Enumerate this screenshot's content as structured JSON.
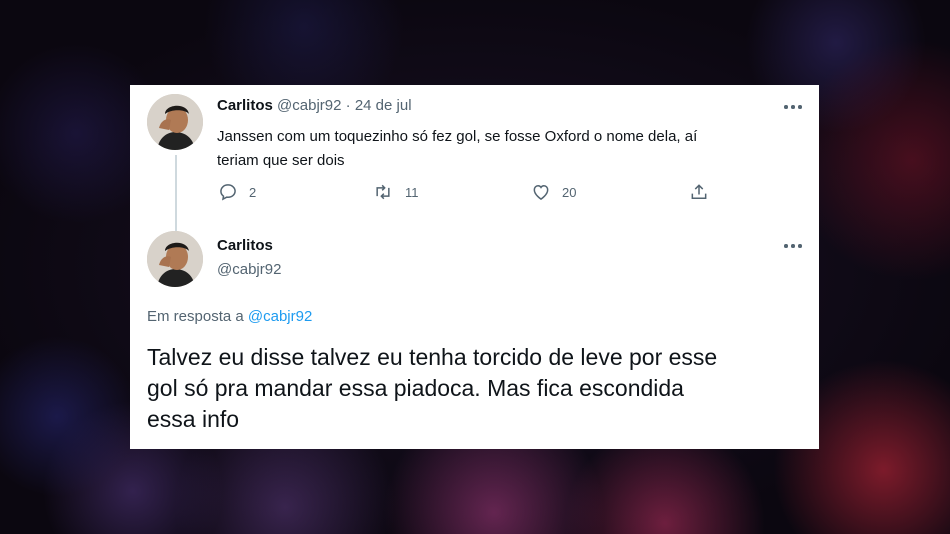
{
  "tweet1": {
    "name": "Carlitos",
    "handle": "@cabjr92",
    "separator": "·",
    "date": "24 de jul",
    "text_line1": "Janssen com um toquezinho só fez gol, se fosse Oxford o nome dela, aí",
    "text_line2": "teriam que ser dois",
    "replies": "2",
    "retweets": "11",
    "likes": "20"
  },
  "tweet2": {
    "name": "Carlitos",
    "handle": "@cabjr92",
    "reply_prefix": "Em resposta a",
    "reply_to": "@cabjr92",
    "text_line1": "Talvez eu disse talvez eu tenha torcido de leve por esse",
    "text_line2": "gol só pra mandar essa piadoca. Mas fica escondida",
    "text_line3": "essa info"
  },
  "colors": {
    "link": "#1d9bf0",
    "text": "#0f1419",
    "muted": "#536471",
    "card": "#ffffff"
  },
  "icons": [
    "more-icon",
    "reply-icon",
    "retweet-icon",
    "like-icon",
    "share-icon"
  ]
}
